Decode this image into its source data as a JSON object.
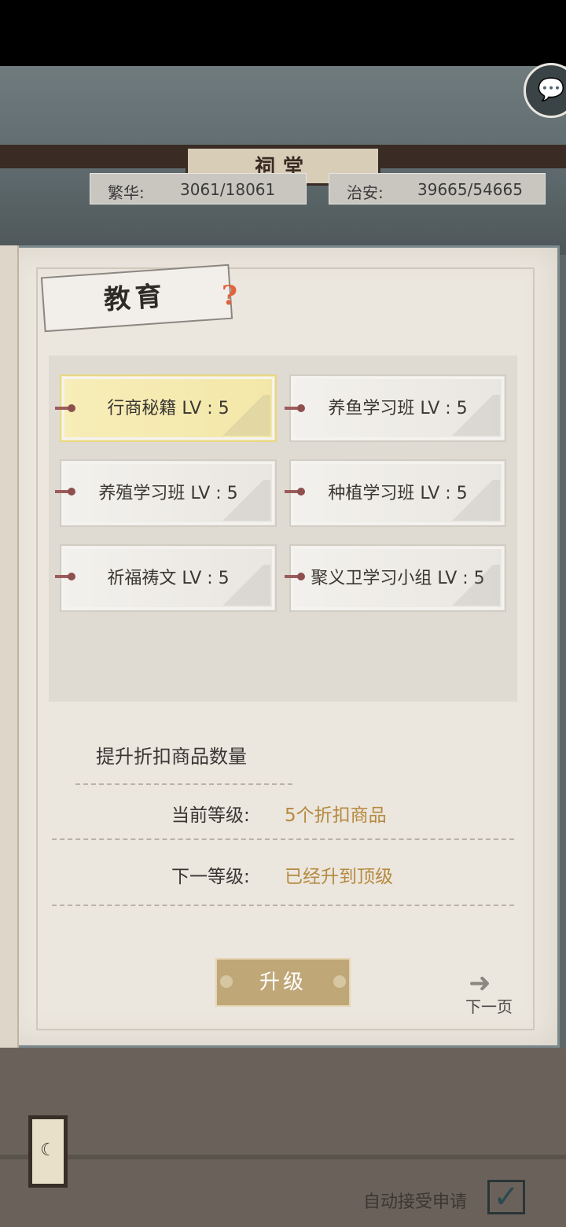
{
  "header": {
    "building_name": "祠堂",
    "stats": [
      {
        "label": "繁华:",
        "value": "3061/18061"
      },
      {
        "label": "治安:",
        "value": "39665/54665"
      }
    ]
  },
  "panel": {
    "title": "教育",
    "items": [
      {
        "label": "行商秘籍 LV : 5",
        "selected": true
      },
      {
        "label": "养鱼学习班 LV : 5",
        "selected": false
      },
      {
        "label": "养殖学习班 LV : 5",
        "selected": false
      },
      {
        "label": "种植学习班 LV : 5",
        "selected": false
      },
      {
        "label": "祈福祷文 LV : 5",
        "selected": false
      },
      {
        "label": "聚义卫学习小组 LV : 5",
        "selected": false
      }
    ],
    "description": "提升折扣商品数量",
    "current_level_label": "当前等级:",
    "current_level_value": "5个折扣商品",
    "next_level_label": "下一等级:",
    "next_level_value": "已经升到顶级",
    "upgrade_button": "升级",
    "next_page": "下一页"
  },
  "footer": {
    "auto_accept_label": "自动接受申请",
    "auto_accept_checked": true
  },
  "colors": {
    "accent_gold": "#b58a3f",
    "selected_card": "#f7edb8",
    "button": "#c0a778"
  }
}
